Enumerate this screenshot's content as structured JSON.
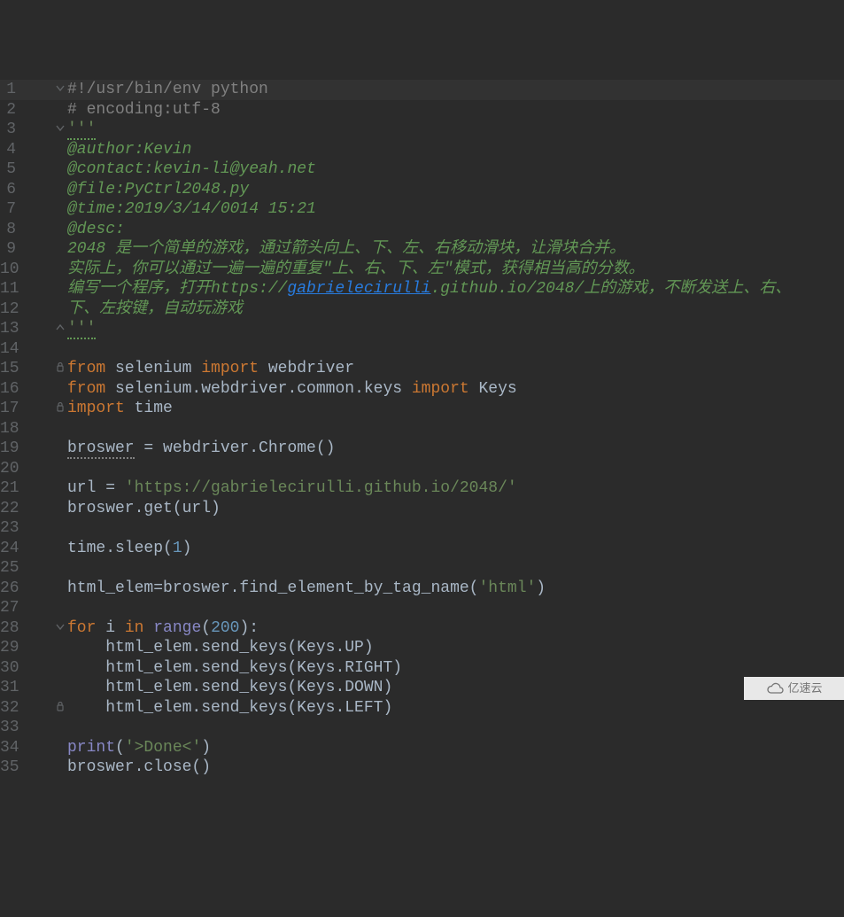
{
  "watermark": {
    "label": "亿速云"
  },
  "lines": [
    {
      "n": "1",
      "hl": true,
      "fold": "down",
      "segs": [
        [
          "cm",
          "#!/usr/bin/env python"
        ]
      ]
    },
    {
      "n": "2",
      "hl": false,
      "fold": "",
      "segs": [
        [
          "cm",
          "# encoding:utf-8"
        ]
      ]
    },
    {
      "n": "3",
      "hl": false,
      "fold": "down",
      "segs": [
        [
          "str",
          "'''"
        ]
      ],
      "typoStr": true
    },
    {
      "n": "4",
      "hl": false,
      "fold": "",
      "segs": [
        [
          "cm-it",
          "@author:Kevin"
        ]
      ]
    },
    {
      "n": "5",
      "hl": false,
      "fold": "",
      "segs": [
        [
          "cm-it",
          "@contact:kevin-li@yeah.net"
        ]
      ]
    },
    {
      "n": "6",
      "hl": false,
      "fold": "",
      "segs": [
        [
          "cm-it",
          "@file:PyCtrl2048.py"
        ]
      ]
    },
    {
      "n": "7",
      "hl": false,
      "fold": "",
      "segs": [
        [
          "cm-it",
          "@time:2019/3/14/0014 15:21"
        ]
      ]
    },
    {
      "n": "8",
      "hl": false,
      "fold": "",
      "segs": [
        [
          "cm-it",
          "@desc:"
        ]
      ]
    },
    {
      "n": "9",
      "hl": false,
      "fold": "",
      "segs": [
        [
          "cm-it",
          "2048 是一个简单的游戏，通过箭头向上、下、左、右移动滑块，让滑块合并。"
        ]
      ]
    },
    {
      "n": "10",
      "hl": false,
      "fold": "",
      "segs": [
        [
          "cm-it",
          "实际上，你可以通过一遍一遍的重复\"上、右、下、左\"模式，获得相当高的分数。"
        ]
      ]
    },
    {
      "n": "11",
      "hl": false,
      "fold": "",
      "segs": [
        [
          "cm-it",
          "编写一个程序，打开"
        ],
        [
          "cm-it",
          "https://"
        ],
        [
          "link",
          "gabrielecirulli"
        ],
        [
          "cm-it",
          ".github.io/2048/"
        ],
        [
          "cm-it",
          "上的游戏，不断发送上、右、"
        ]
      ]
    },
    {
      "n": "12",
      "hl": false,
      "fold": "",
      "segs": [
        [
          "cm-it",
          "下、左按键，自动玩游戏"
        ]
      ]
    },
    {
      "n": "13",
      "hl": false,
      "fold": "up",
      "segs": [
        [
          "str",
          "'''"
        ]
      ],
      "typoStr": true
    },
    {
      "n": "14",
      "hl": false,
      "fold": "",
      "segs": []
    },
    {
      "n": "15",
      "hl": false,
      "fold": "lock",
      "segs": [
        [
          "kw",
          "from"
        ],
        [
          "",
          " selenium "
        ],
        [
          "kw",
          "import"
        ],
        [
          "",
          " webdriver"
        ]
      ]
    },
    {
      "n": "16",
      "hl": false,
      "fold": "",
      "segs": [
        [
          "kw",
          "from"
        ],
        [
          "",
          " selenium.webdriver.common.keys "
        ],
        [
          "kw",
          "import"
        ],
        [
          "",
          " Keys"
        ]
      ]
    },
    {
      "n": "17",
      "hl": false,
      "fold": "lock",
      "segs": [
        [
          "kw",
          "import"
        ],
        [
          "",
          " time"
        ]
      ]
    },
    {
      "n": "18",
      "hl": false,
      "fold": "",
      "segs": []
    },
    {
      "n": "19",
      "hl": false,
      "fold": "",
      "segs": [
        [
          "typo2",
          "broswer"
        ],
        [
          "",
          " = webdriver.Chrome()"
        ]
      ]
    },
    {
      "n": "20",
      "hl": false,
      "fold": "",
      "segs": []
    },
    {
      "n": "21",
      "hl": false,
      "fold": "",
      "segs": [
        [
          "",
          "url = "
        ],
        [
          "str",
          "'https://gabrielecirulli.github.io/2048/'"
        ]
      ]
    },
    {
      "n": "22",
      "hl": false,
      "fold": "",
      "segs": [
        [
          "",
          "broswer.get(url)"
        ]
      ]
    },
    {
      "n": "23",
      "hl": false,
      "fold": "",
      "segs": []
    },
    {
      "n": "24",
      "hl": false,
      "fold": "",
      "segs": [
        [
          "",
          "time.sleep("
        ],
        [
          "num",
          "1"
        ],
        [
          "",
          ")"
        ]
      ]
    },
    {
      "n": "25",
      "hl": false,
      "fold": "",
      "segs": []
    },
    {
      "n": "26",
      "hl": false,
      "fold": "",
      "segs": [
        [
          "",
          "html_elem=broswer.find_element_by_tag_name("
        ],
        [
          "str",
          "'html'"
        ],
        [
          "",
          ")"
        ]
      ]
    },
    {
      "n": "27",
      "hl": false,
      "fold": "",
      "segs": []
    },
    {
      "n": "28",
      "hl": false,
      "fold": "down",
      "segs": [
        [
          "kw",
          "for"
        ],
        [
          "",
          " i "
        ],
        [
          "kw",
          "in"
        ],
        [
          "",
          " "
        ],
        [
          "builtin",
          "range"
        ],
        [
          "",
          "("
        ],
        [
          "num",
          "200"
        ],
        [
          "",
          "):"
        ]
      ]
    },
    {
      "n": "29",
      "hl": false,
      "fold": "",
      "segs": [
        [
          "",
          "    html_elem.send_keys(Keys.UP)"
        ]
      ]
    },
    {
      "n": "30",
      "hl": false,
      "fold": "",
      "segs": [
        [
          "",
          "    html_elem.send_keys(Keys.RIGHT)"
        ]
      ]
    },
    {
      "n": "31",
      "hl": false,
      "fold": "",
      "segs": [
        [
          "",
          "    html_elem.send_keys(Keys.DOWN)"
        ]
      ]
    },
    {
      "n": "32",
      "hl": false,
      "fold": "lock",
      "segs": [
        [
          "",
          "    html_elem.send_keys(Keys.LEFT)"
        ]
      ]
    },
    {
      "n": "33",
      "hl": false,
      "fold": "",
      "segs": []
    },
    {
      "n": "34",
      "hl": false,
      "fold": "",
      "segs": [
        [
          "builtin",
          "print"
        ],
        [
          "",
          "("
        ],
        [
          "str",
          "'>Done<'"
        ],
        [
          "",
          ")"
        ]
      ]
    },
    {
      "n": "35",
      "hl": false,
      "fold": "",
      "segs": [
        [
          "",
          "broswer.close()"
        ]
      ]
    }
  ]
}
